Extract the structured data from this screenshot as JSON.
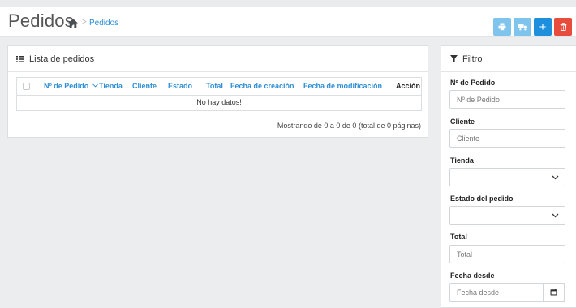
{
  "header": {
    "title": "Pedidos",
    "breadcrumb": "Pedidos",
    "accent_color": "#1d8fdc",
    "danger_color": "#e74c3c",
    "light_button_color": "#7fc4ec",
    "buttons": [
      {
        "name": "print-button",
        "icon": "print-icon"
      },
      {
        "name": "ship-button",
        "icon": "truck-icon"
      },
      {
        "name": "add-button",
        "icon": "plus-icon",
        "label": "+"
      },
      {
        "name": "delete-button",
        "icon": "trash-icon"
      }
    ]
  },
  "orders": {
    "title": "Lista de pedidos",
    "icon": "list-icon",
    "columns": [
      "Nº de Pedido",
      "Tienda",
      "Cliente",
      "Estado",
      "Total",
      "Fecha de creación",
      "Fecha de modificación",
      "Acción"
    ],
    "sorted_column": "Nº de Pedido",
    "sort_direction_icon": "chevron-down-icon",
    "empty_message": "No hay datos!",
    "pagination_info": "Mostrando de 0 a 0 de 0 (total de 0 páginas)"
  },
  "filter": {
    "title": "Filtro",
    "icon": "funnel-icon",
    "fields": {
      "order_number": {
        "label": "Nº de Pedido",
        "placeholder": "Nº de Pedido",
        "value": ""
      },
      "customer": {
        "label": "Cliente",
        "placeholder": "Cliente",
        "value": ""
      },
      "store": {
        "label": "Tienda",
        "value": ""
      },
      "order_status": {
        "label": "Estado del pedido",
        "value": ""
      },
      "total": {
        "label": "Total",
        "placeholder": "Total",
        "value": ""
      },
      "date_from": {
        "label": "Fecha desde",
        "placeholder": "Fecha desde",
        "value": ""
      }
    }
  }
}
